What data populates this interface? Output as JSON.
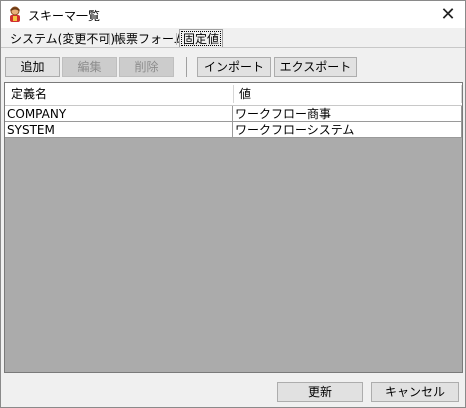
{
  "window": {
    "title": "スキーマ一覧"
  },
  "tabs": [
    {
      "label": "システム(変更不可)"
    },
    {
      "label": "帳票フォーム"
    },
    {
      "label": "固定値"
    }
  ],
  "toolbar": {
    "add": "追加",
    "edit": "編集",
    "delete": "削除",
    "import": "インポート",
    "export": "エクスポート"
  },
  "table": {
    "columns": [
      "定義名",
      "値"
    ],
    "rows": [
      [
        "COMPANY",
        "ワークフロー商事"
      ],
      [
        "SYSTEM",
        "ワークフローシステム"
      ]
    ]
  },
  "footer": {
    "update": "更新",
    "cancel": "キャンセル"
  }
}
